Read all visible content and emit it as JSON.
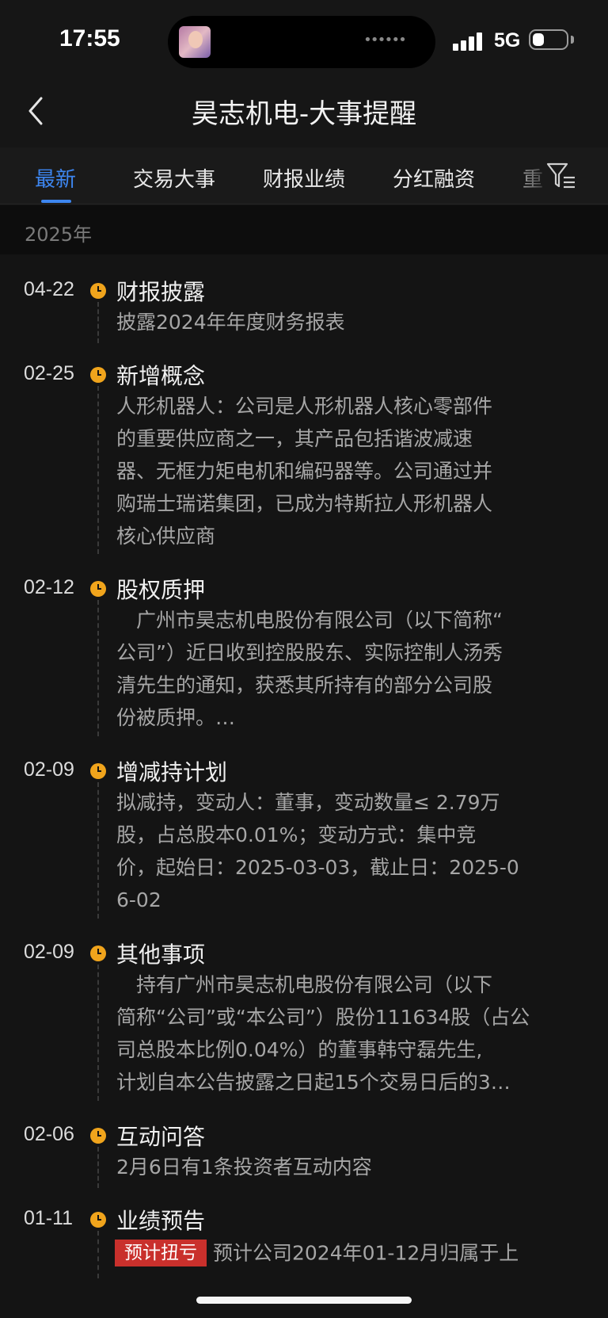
{
  "status_bar": {
    "time": "17:55",
    "network": "5G",
    "battery_fraction": 0.35,
    "signal_bars": 4
  },
  "header": {
    "title": "昊志机电-大事提醒",
    "back_icon": "chevron-left-icon"
  },
  "tabs": [
    {
      "label": "最新",
      "active": true
    },
    {
      "label": "交易大事",
      "active": false
    },
    {
      "label": "财报业绩",
      "active": false
    },
    {
      "label": "分红融资",
      "active": false
    },
    {
      "label": "重",
      "active": false
    }
  ],
  "filter_icon": "filter-icon",
  "year": "2025年",
  "events": [
    {
      "date": "04-22",
      "title": "财报披露",
      "body": "披露2024年年度财务报表"
    },
    {
      "date": "02-25",
      "title": "新增概念",
      "body_lines": [
        "人形机器人：公司是人形机器人核心零部件",
        "的重要供应商之一，其产品包括谐波减速",
        "器、无框力矩电机和编码器等。公司通过并",
        "购瑞士瑞诺集团，已成为特斯拉人形机器人",
        "核心供应商"
      ]
    },
    {
      "date": "02-12",
      "title": "股权质押",
      "body_lines": [
        "　广州市昊志机电股份有限公司（以下简称“",
        "公司”）近日收到控股股东、实际控制人汤秀",
        "清先生的通知，获悉其所持有的部分公司股",
        "份被质押。…"
      ]
    },
    {
      "date": "02-09",
      "title": "增减持计划",
      "body_lines": [
        "拟减持，变动人：董事，变动数量≤ 2.79万",
        "股，占总股本0.01%；变动方式：集中竞",
        "价，起始日：2025-03-03，截止日：2025-0",
        "6-02"
      ]
    },
    {
      "date": "02-09",
      "title": "其他事项",
      "body_lines": [
        "　持有广州市昊志机电股份有限公司（以下",
        "简称“公司”或“本公司”）股份111634股（占公",
        "司总股本比例0.04%）的董事韩守磊先生,",
        "计划自本公告披露之日起15个交易日后的3…"
      ]
    },
    {
      "date": "02-06",
      "title": "互动问答",
      "body": "2月6日有1条投资者互动内容"
    },
    {
      "date": "01-11",
      "title": "业绩预告",
      "tag": "预计扭亏",
      "tag_color": "#c9302c",
      "body": "预计公司2024年01-12月归属于上"
    }
  ],
  "colors": {
    "accent": "#3d86f0",
    "clock": "#f0a41c",
    "background": "#141414"
  }
}
